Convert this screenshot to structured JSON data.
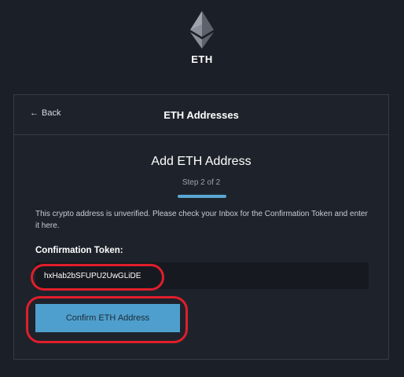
{
  "coin": {
    "symbol": "ETH",
    "icon": "ethereum-icon"
  },
  "header": {
    "back_label": "Back",
    "back_icon": "arrow-left-icon",
    "title": "ETH Addresses"
  },
  "form": {
    "title": "Add ETH Address",
    "step_label": "Step 2 of 2",
    "info": "This crypto address is unverified. Please check your Inbox for the Confirmation Token and enter it here.",
    "token_label": "Confirmation Token:",
    "token_value": "hxHab2bSFUPU2UwGLiDE",
    "confirm_label": "Confirm ETH Address"
  },
  "colors": {
    "background": "#1b1f27",
    "accent": "#4e9fcd",
    "highlight": "#e01e2b"
  }
}
